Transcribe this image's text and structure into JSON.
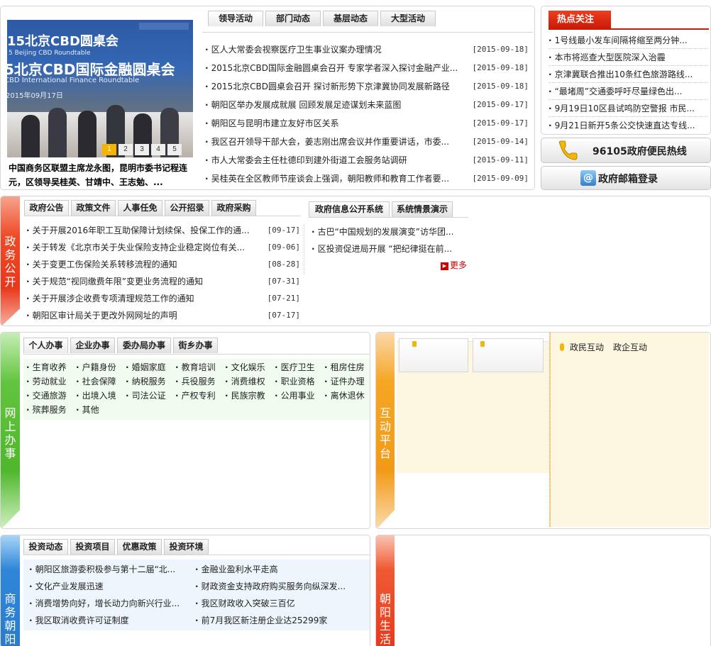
{
  "feature": {
    "banner_lines": [
      "15北京CBD圆桌会",
      "5北京CBD国际金融圆桌会",
      "5 Beijing CBD Roundtable",
      "CBD International Finance Roundtable",
      "2015年09月17日"
    ],
    "pager": [
      "1",
      "2",
      "3",
      "4",
      "5"
    ],
    "active_page": 1,
    "caption": "中国商务区联盟主席龙永图，昆明市委书记程连元，区领导吴桂英、甘靖中、王志勉、...",
    "tabs": [
      "领导活动",
      "部门动态",
      "基层动态",
      "大型活动"
    ],
    "news": [
      {
        "title": "区人大常委会视察医疗卫生事业议案办理情况",
        "date": "[2015-09-18]"
      },
      {
        "title": "2015北京CBD国际金融圆桌会召开 专家学者深入探讨金融产业...",
        "date": "[2015-09-18]"
      },
      {
        "title": "2015北京CBD圆桌会召开 探讨新形势下京津冀协同发展新路径",
        "date": "[2015-09-18]"
      },
      {
        "title": "朝阳区举办发展成就展 回顾发展足迹谋划未来蓝图",
        "date": "[2015-09-17]"
      },
      {
        "title": "朝阳区与昆明市建立友好市区关系",
        "date": "[2015-09-17]"
      },
      {
        "title": "我区召开领导干部大会，姜志刚出席会议并作重要讲话，市委...",
        "date": "[2015-09-14]"
      },
      {
        "title": "市人大常委会主任杜德印到建外街道工会服务站调研",
        "date": "[2015-09-11]"
      },
      {
        "title": "吴桂英在全区教师节座谈会上强调，朝阳教师和教育工作者要...",
        "date": "[2015-09-09]"
      }
    ]
  },
  "hot": {
    "title": "热点关注",
    "items": [
      "1号线最小发车间隔将缩至两分钟...",
      "本市将巡查大型医院深入治霾",
      "京津冀联合推出10条红色旅游路线...",
      "“最堵周”交通委呼吁尽量绿色出...",
      "9月19日10区县试鸣防空警报 市民...",
      "9月21日新开5条公交快速直达专线..."
    ]
  },
  "hotline": {
    "label": "96105政府便民热线"
  },
  "mail": {
    "label": "政府邮箱登录"
  },
  "gov": {
    "side_label": [
      "政",
      "务",
      "公",
      "开"
    ],
    "tabs_left": [
      "政府公告",
      "政策文件",
      "人事任免",
      "公开招录",
      "政府采购"
    ],
    "tabs_right": [
      "政府信息公开系统",
      "系统情景演示"
    ],
    "notices": [
      {
        "title": "关于开展2016年职工互助保障计划续保、投保工作的通...",
        "date": "[09-17]"
      },
      {
        "title": "关于转发《北京市关于失业保险支持企业稳定岗位有关...",
        "date": "[09-06]"
      },
      {
        "title": "关于变更工伤保险关系转移流程的通知",
        "date": "[08-28]"
      },
      {
        "title": "关于规范“视同缴费年限”变更业务流程的通知",
        "date": "[07-31]"
      },
      {
        "title": "关于开展涉企收费专项清理规范工作的通知",
        "date": "[07-21]"
      },
      {
        "title": "朝阳区审计局关于更改外网网址的声明",
        "date": "[07-17]"
      }
    ],
    "info": [
      "古巴“中国规划的发展演变”访华团...",
      "区投资促进局开展 “把纪律挺在前..."
    ],
    "more": "更多"
  },
  "online": {
    "side_label": [
      "网",
      "上",
      "办",
      "事"
    ],
    "tabs": [
      "个人办事",
      "企业办事",
      "委办局办事",
      "街乡办事"
    ],
    "services": [
      [
        "生育收养",
        "户籍身份",
        "婚姻家庭",
        "教育培训",
        "文化娱乐",
        "医疗卫生",
        "租房住房"
      ],
      [
        "劳动就业",
        "社会保障",
        "纳税服务",
        "兵役服务",
        "消费维权",
        "职业资格",
        "证件办理"
      ],
      [
        "交通旅游",
        "出境入境",
        "司法公证",
        "产权专利",
        "民族宗教",
        "公用事业",
        "离休退休"
      ],
      [
        "殡葬服务",
        "其他"
      ]
    ]
  },
  "interactive": {
    "side_label": [
      "互",
      "动",
      "平",
      "台"
    ],
    "links": [
      "政民互动",
      "政企互动"
    ]
  },
  "business": {
    "side_label": [
      "商",
      "务",
      "朝",
      "阳"
    ],
    "tabs": [
      "投资动态",
      "投资项目",
      "优惠政策",
      "投资环境"
    ],
    "left": [
      "朝阳区旅游委积极参与第十二届“北...",
      "文化产业发展迅速",
      "消费增势向好，增长动力向新兴行业...",
      "我区取消收费许可证制度"
    ],
    "right": [
      "金融业盈利水平走高",
      "财政资金支持政府购买服务向纵深发...",
      "我区财政收入突破三百亿",
      "前7月我区新注册企业达25299家"
    ]
  },
  "life": {
    "side_label": [
      "朝",
      "阳",
      "生",
      "活"
    ]
  },
  "colors": {
    "red": "#e8381b",
    "green": "#5cc03a",
    "orange": "#f29a18",
    "blue": "#2f86d8",
    "link_red": "#cc0000"
  }
}
